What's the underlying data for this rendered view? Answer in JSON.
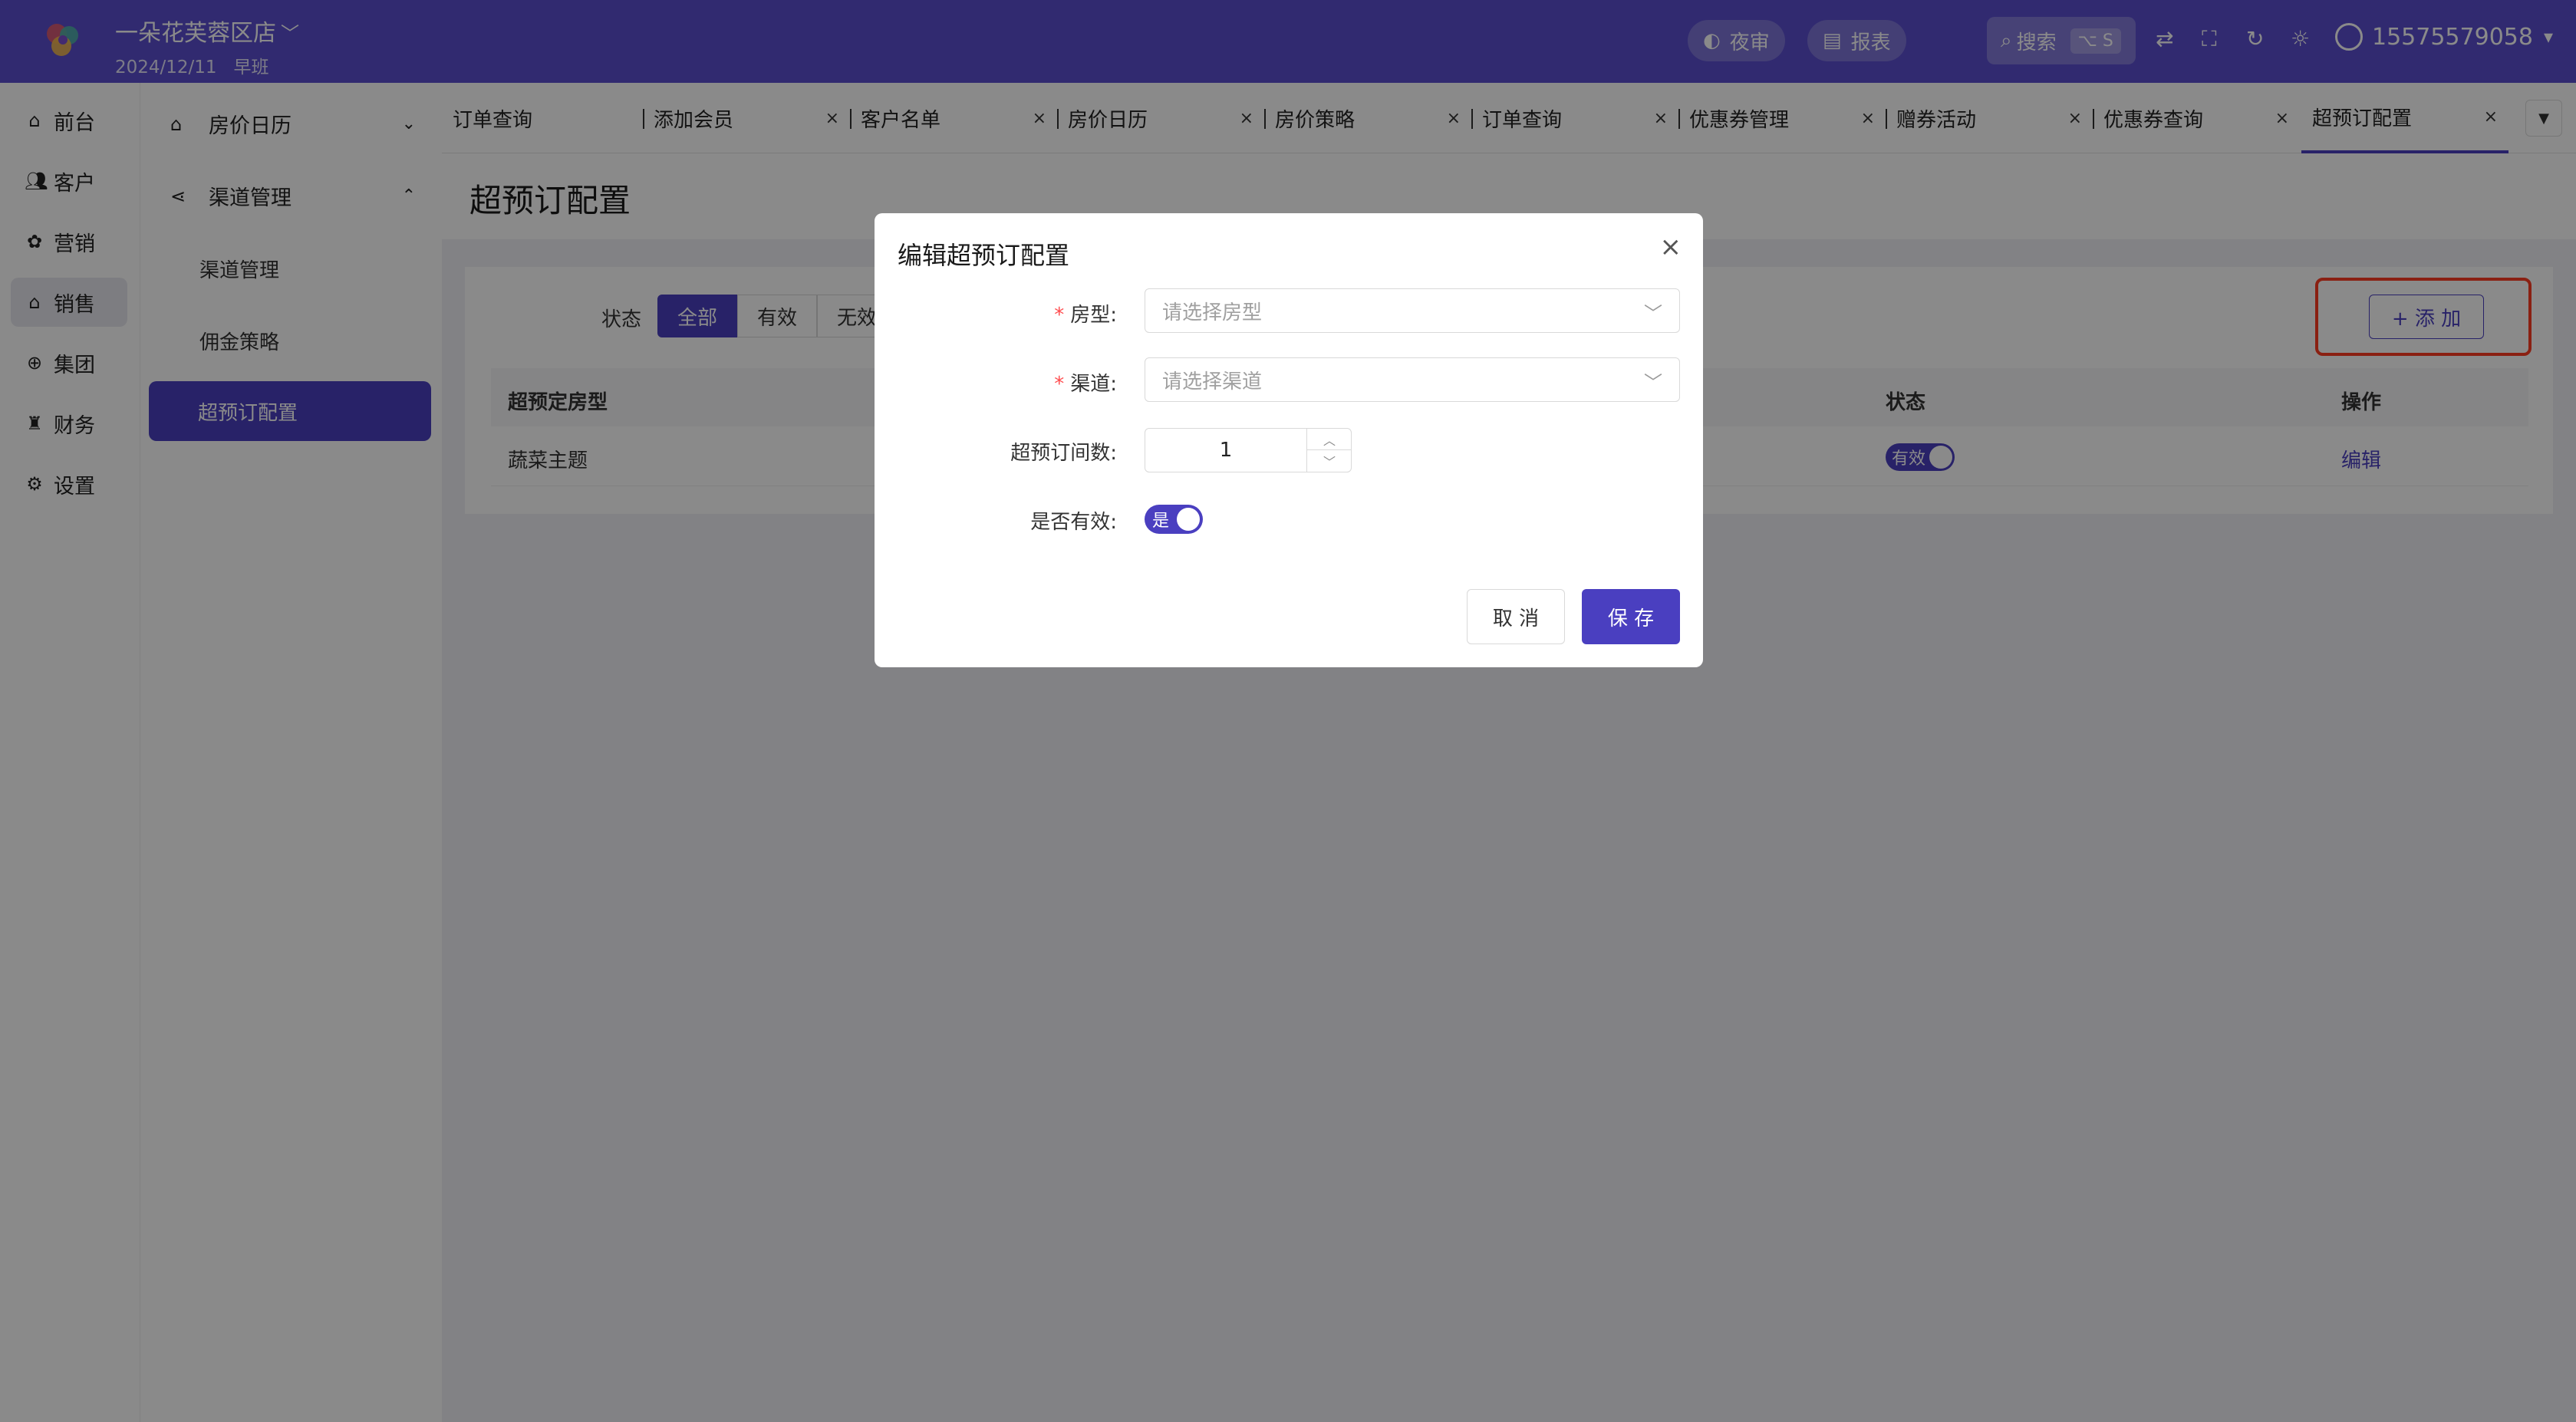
{
  "header": {
    "store_name": "一朵花芙蓉区店",
    "store_caret": "﹀",
    "date": "2024/12/11",
    "shift": "早班",
    "night_audit_label": "夜审",
    "report_label": "报表",
    "search_label": "搜索",
    "search_shortcut": "⌥ S",
    "user_phone": "15575579058",
    "user_caret": "▾"
  },
  "rail": {
    "items": [
      {
        "label": "前台",
        "icon": "home-icon"
      },
      {
        "label": "客户",
        "icon": "users-icon"
      },
      {
        "label": "营销",
        "icon": "marketing-icon"
      },
      {
        "label": "销售",
        "icon": "sales-icon"
      },
      {
        "label": "集团",
        "icon": "globe-icon"
      },
      {
        "label": "财务",
        "icon": "finance-icon"
      },
      {
        "label": "设置",
        "icon": "settings-icon"
      }
    ],
    "active_index": 3
  },
  "subnav": {
    "group1": "房价日历",
    "group2": "渠道管理",
    "items": [
      "渠道管理",
      "佣金策略",
      "超预订配置"
    ],
    "active": "超预订配置",
    "chev_down": "⌄",
    "chev_up": "⌃"
  },
  "tabs": {
    "items": [
      {
        "label": "订单查询",
        "closable": false
      },
      {
        "label": "添加会员",
        "closable": true
      },
      {
        "label": "客户名单",
        "closable": true
      },
      {
        "label": "房价日历",
        "closable": true
      },
      {
        "label": "房价策略",
        "closable": true
      },
      {
        "label": "订单查询",
        "closable": true
      },
      {
        "label": "优惠券管理",
        "closable": true
      },
      {
        "label": "赠券活动",
        "closable": true
      },
      {
        "label": "优惠券查询",
        "closable": true
      },
      {
        "label": "超预订配置",
        "closable": true
      }
    ],
    "close_glyph": "×",
    "more_glyph": "▼"
  },
  "page": {
    "title": "超预订配置",
    "filter_label": "状态",
    "filter_options": [
      "全部",
      "有效",
      "无效"
    ],
    "filter_selected": "全部",
    "add_button": "+ 添 加",
    "table_headers": {
      "room_type": "超预定房型",
      "status": "状态",
      "action": "操作"
    },
    "rows": [
      {
        "room_type": "蔬菜主题",
        "status": "有效",
        "action": "编辑"
      }
    ]
  },
  "modal": {
    "title": "编辑超预订配置",
    "close_glyph": "×",
    "fields": {
      "room_type": {
        "label": "房型:",
        "placeholder": "请选择房型",
        "required": true
      },
      "channel": {
        "label": "渠道:",
        "placeholder": "请选择渠道",
        "required": true
      },
      "overbook_count": {
        "label": "超预订间数:",
        "value": "1"
      },
      "is_valid": {
        "label": "是否有效:",
        "value": "是"
      }
    },
    "required_mark": "*",
    "select_arrow": "﹀",
    "stepper_up": "︿",
    "stepper_down": "﹀",
    "cancel_label": "取 消",
    "save_label": "保 存"
  },
  "colors": {
    "topbar": "#5b4fcf",
    "primary": "#4a3fc0",
    "highlight": "#ff3b22"
  }
}
